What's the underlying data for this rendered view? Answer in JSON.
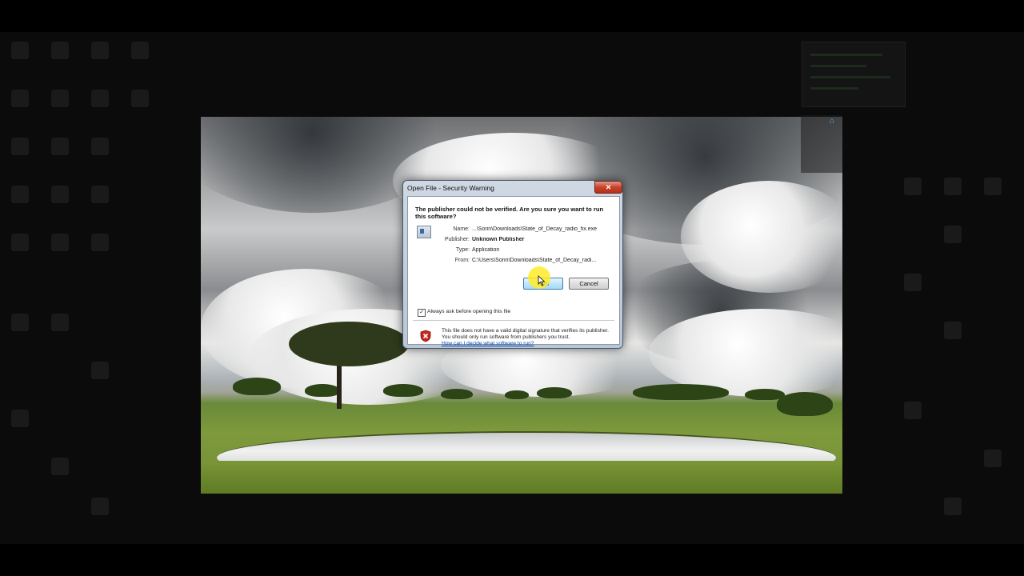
{
  "dialog": {
    "title": "Open File - Security Warning",
    "close_glyph": "✕",
    "headline": "The publisher could not be verified.  Are you sure you want to run this software?",
    "file_icon": "application-icon",
    "properties": [
      {
        "label": "Name:",
        "value": "...\\Sorin\\Downloads\\State_of_Decay_radio_fix.exe",
        "bold": false
      },
      {
        "label": "Publisher:",
        "value": "Unknown Publisher",
        "bold": true
      },
      {
        "label": "Type:",
        "value": "Application",
        "bold": false
      },
      {
        "label": "From:",
        "value": "C:\\Users\\Sorin\\Downloads\\State_of_Decay_radi...",
        "bold": false
      }
    ],
    "run_label": "Run",
    "cancel_label": "Cancel",
    "always_ask_label": "Always ask before opening this file",
    "always_ask_checked": true,
    "check_glyph": "✓",
    "warning_text": "This file does not have a valid digital signature that verifies its publisher.  You should only run software from publishers you trust.",
    "warning_link": "How can I decide what software to run?"
  },
  "colors": {
    "accent": "#3c7fb1",
    "close": "#c7432a",
    "link": "#0645ad",
    "highlight": "#ffeb28"
  }
}
